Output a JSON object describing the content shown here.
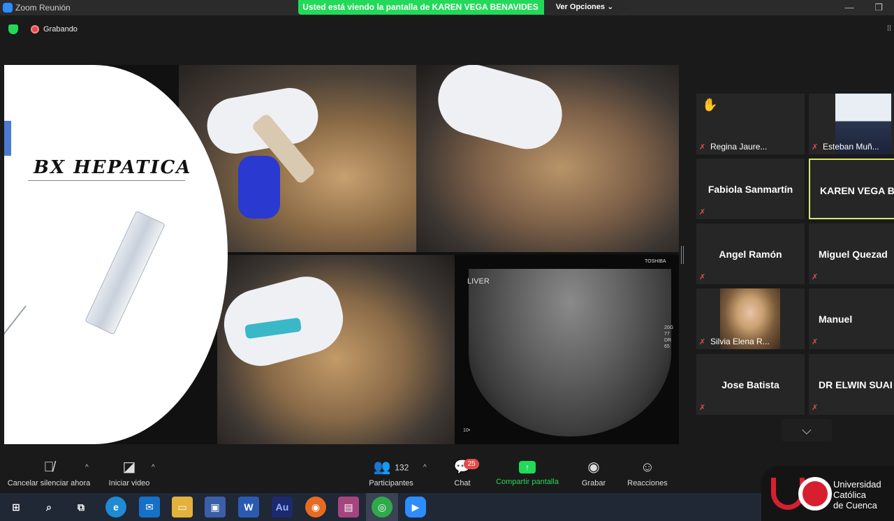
{
  "window": {
    "title": "Zoom Reunión",
    "share_banner": "Usted está viendo la pantalla de KAREN VEGA BENAVIDES",
    "view_options": "Ver Opciones"
  },
  "recording": {
    "label": "Grabando"
  },
  "slide": {
    "title": "BX HEPATICA",
    "ultrasound": {
      "organ_label": "LIVER",
      "brand": "TOSHIBA",
      "scale_readout": "20G\n77\nDR\n65",
      "depth": "10•"
    }
  },
  "participants": [
    {
      "name": "Regina Jaure...",
      "muted": true,
      "hand_raised": true
    },
    {
      "name": "Esteban Muñ...",
      "muted": true,
      "has_video": true
    },
    {
      "name": "Fabiola Sanmartín",
      "muted": true
    },
    {
      "name": "KAREN VEGA BE",
      "muted": false,
      "active_speaker": true
    },
    {
      "name": "Angel Ramón",
      "muted": true
    },
    {
      "name": "Miguel Quezad",
      "muted": true
    },
    {
      "name": "Silvia Elena R...",
      "muted": true,
      "has_video": true
    },
    {
      "name": "Manuel",
      "muted": true
    },
    {
      "name": "Jose Batista",
      "muted": true
    },
    {
      "name": "DR ELWIN SUAI",
      "muted": true
    }
  ],
  "toolbar": {
    "mute": "Cancelar silenciar ahora",
    "video": "Iniciar video",
    "participants_label": "Participantes",
    "participants_count": "132",
    "chat": "Chat",
    "chat_badge": "25",
    "share": "Compartir pantalla",
    "record": "Grabar",
    "reactions": "Reacciones"
  },
  "taskbar": {
    "word": "W",
    "audition": "Au"
  },
  "university": {
    "line1": "Universidad",
    "line2": "Católica",
    "line3": "de Cuenca"
  },
  "colors": {
    "share_green": "#23d959",
    "mute_red": "#e34b4b",
    "active_speaker": "#d8e873",
    "uni_red": "#d62030"
  }
}
